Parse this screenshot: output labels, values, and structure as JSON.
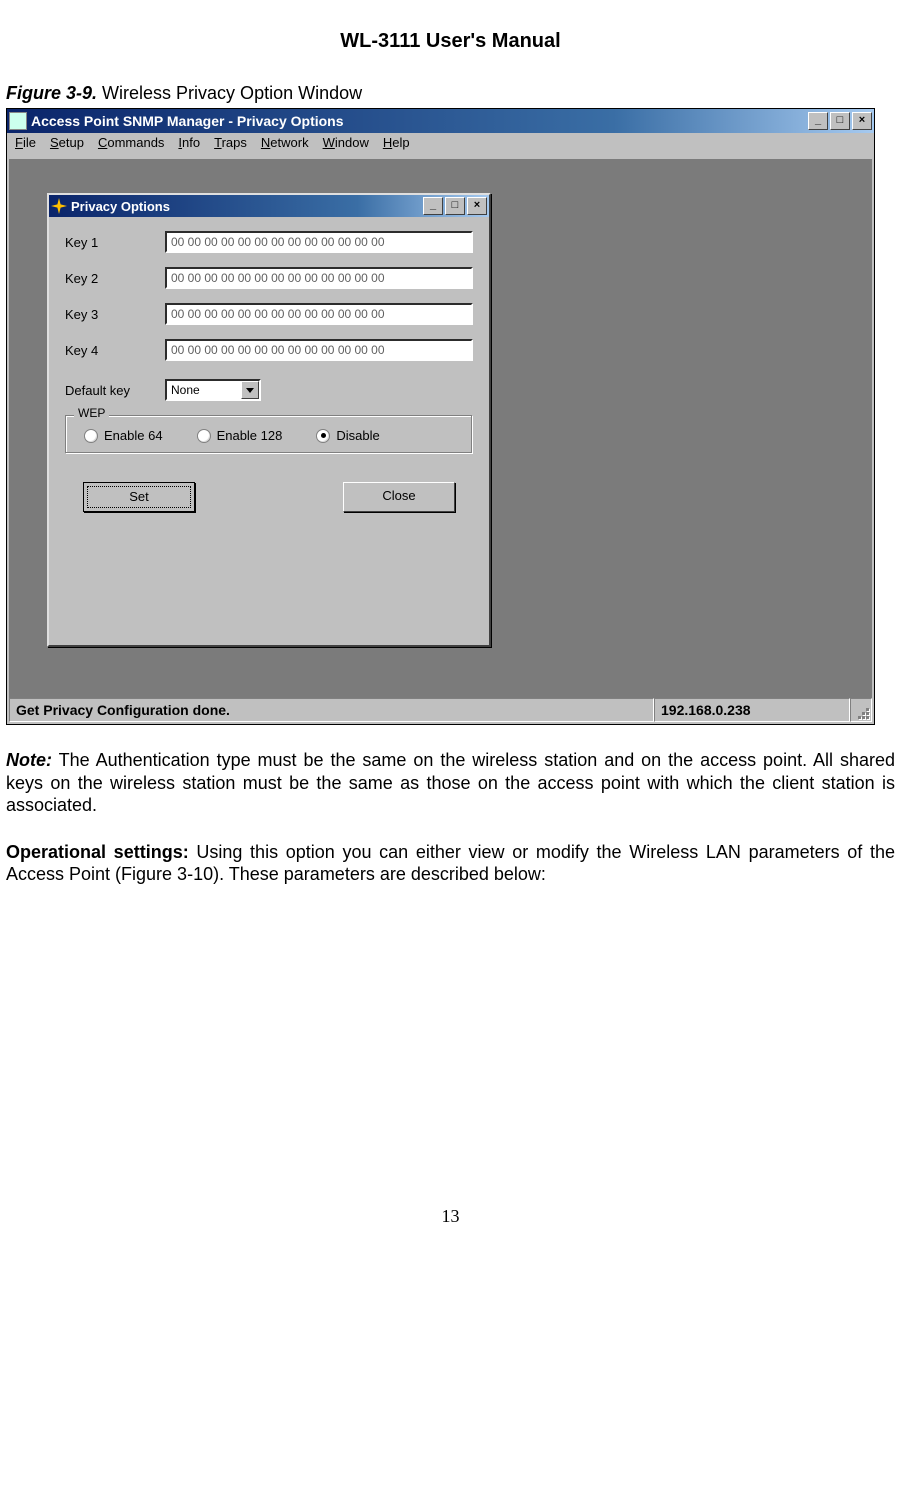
{
  "doc": {
    "title": "WL-3111 User's Manual",
    "figure_label": "Figure 3-9.",
    "figure_caption": "Wireless Privacy Option Window",
    "note_label": "Note:",
    "note_text": " The Authentication type must be the same on the wireless station and on the access point. All shared keys on the wireless station must be the same as those on the access point with which the client station is associated.",
    "opset_label": "Operational settings:",
    "opset_text": " Using this option you can either view or modify the Wireless LAN parameters of the Access Point (Figure 3-10). These parameters are described below:",
    "page_number": "13"
  },
  "app": {
    "title": "Access Point SNMP Manager -  Privacy Options",
    "menus": [
      "File",
      "Setup",
      "Commands",
      "Info",
      "Traps",
      "Network",
      "Window",
      "Help"
    ],
    "status_message": "Get Privacy Configuration done.",
    "ip_address": "192.168.0.238"
  },
  "dialog": {
    "title": "Privacy Options",
    "keys": [
      {
        "label": "Key 1",
        "value": "00 00 00 00 00 00 00 00 00 00 00 00 00"
      },
      {
        "label": "Key 2",
        "value": "00 00 00 00 00 00 00 00 00 00 00 00 00"
      },
      {
        "label": "Key 3",
        "value": "00 00 00 00 00 00 00 00 00 00 00 00 00"
      },
      {
        "label": "Key 4",
        "value": "00 00 00 00 00 00 00 00 00 00 00 00 00"
      }
    ],
    "default_key_label": "Default key",
    "default_key_value": "None",
    "wep": {
      "group_label": "WEP",
      "options": [
        "Enable 64",
        "Enable 128",
        "Disable"
      ],
      "selected_index": 2
    },
    "buttons": {
      "set": "Set",
      "close": "Close"
    }
  }
}
